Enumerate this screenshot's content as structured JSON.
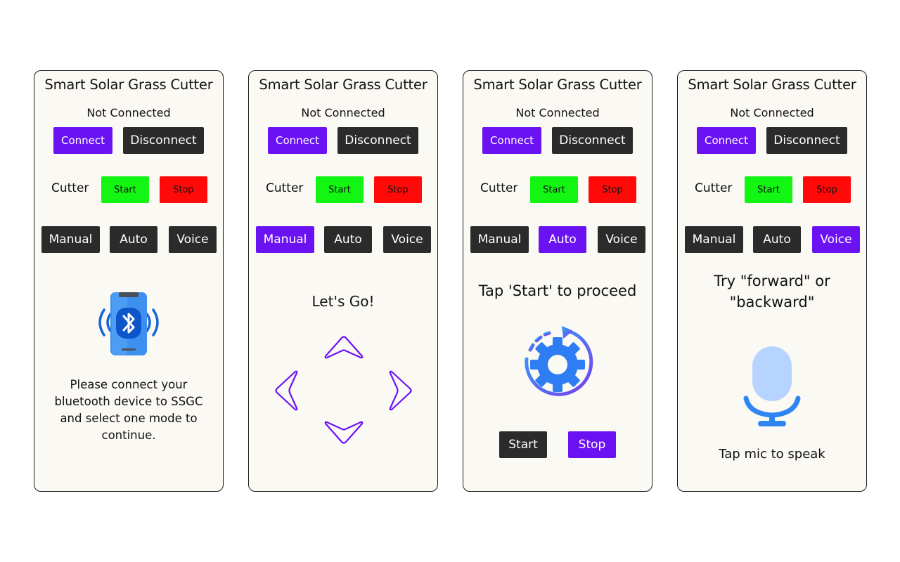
{
  "app": {
    "title": "Smart Solar Grass Cutter"
  },
  "connection": {
    "status": "Not Connected",
    "connect_label": "Connect",
    "disconnect_label": "Disconnect"
  },
  "cutter": {
    "label": "Cutter",
    "start_label": "Start",
    "stop_label": "Stop"
  },
  "modes": {
    "manual": "Manual",
    "auto": "Auto",
    "voice": "Voice"
  },
  "screens": {
    "home": {
      "message": "Please connect your bluetooth device to SSGC and select one mode to continue.",
      "icon": "bluetooth-phone-icon"
    },
    "manual": {
      "heading": "Let's Go!",
      "active_mode": "Manual"
    },
    "auto": {
      "heading": "Tap 'Start' to proceed",
      "start_label": "Start",
      "stop_label": "Stop",
      "active_mode": "Auto",
      "icon": "gear-icon"
    },
    "voice": {
      "heading": "Try \"forward\" or \"backward\"",
      "hint": "Tap mic to speak",
      "active_mode": "Voice",
      "icon": "mic-icon"
    }
  },
  "colors": {
    "accent": "#6b12f3",
    "dark_button": "#2b2b2b",
    "start_green": "#13f513",
    "stop_red": "#ff0909",
    "screen_bg": "#fbf9f4",
    "bluetooth_blue": "#1565d8",
    "mic_light_blue": "#b7d3ff",
    "mic_blue": "#2f86f2"
  }
}
